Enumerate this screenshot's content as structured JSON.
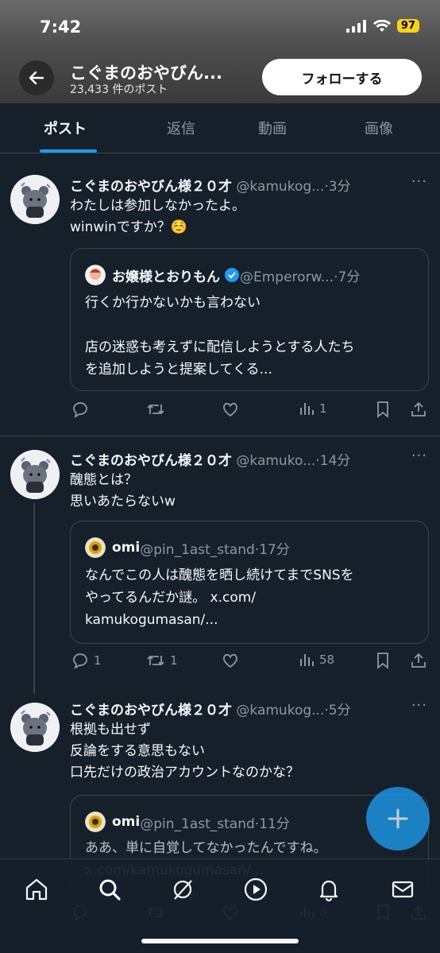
{
  "status": {
    "time": "7:42",
    "battery": "97"
  },
  "header": {
    "title": "こぐまのおやびん...",
    "subtitle": "23,433 件のポスト",
    "follow_label": "フォローする"
  },
  "tabs": [
    {
      "label": "ポスト"
    },
    {
      "label": "返信"
    },
    {
      "label": "動画"
    },
    {
      "label": "画像"
    }
  ],
  "posts": [
    {
      "name": "こぐまのおやびん様２０才",
      "meta": " @kamukog...·3分",
      "text": "わたしは参加しなかったよ。\nwinwinですか？☺️",
      "quote": {
        "name": "お嬢様とおりもん",
        "meta": " @Emperorw...·7分",
        "text": "行くか行かないかも言わない\n\n店の迷惑も考えずに配信しようとする人たち\nを追加しようと提案してくる..."
      },
      "reply_count": "",
      "retweet_count": "",
      "views": "1"
    },
    {
      "name": "こぐまのおやびん様２０才",
      "meta": " @kamuko...·14分",
      "text": "醜態とは？\n思いあたらないw",
      "quote": {
        "name": "omi",
        "meta": " @pin_1ast_stand·17分",
        "text": "なんでこの人は醜態を晒し続けてまでSNSを\nやってるんだか謎。 x.com/\nkamukogumasan/..."
      },
      "reply_count": "1",
      "retweet_count": "1",
      "views": "58"
    },
    {
      "name": "こぐまのおやびん様２０才",
      "meta": " @kamukog...·5分",
      "text": "根拠も出せず\n反論をする意思もない\n口先だけの政治アカウントなのかな？",
      "quote": {
        "name": "omi",
        "meta": " @pin_1ast_stand·11分",
        "text": "ああ、単に自覚してなかったんですね。\nx.com/kamukogumasan/..."
      },
      "reply_count": "",
      "retweet_count": "",
      "views": "3"
    }
  ],
  "more_glyph": "···",
  "colors": {
    "accent": "#1d9bf0",
    "background": "#15202b",
    "muted": "#8b98a5",
    "verified": "#1d9bf0"
  },
  "nav_icons": [
    "home-icon",
    "search-icon",
    "grok-icon",
    "play-icon",
    "bell-icon",
    "mail-icon"
  ]
}
